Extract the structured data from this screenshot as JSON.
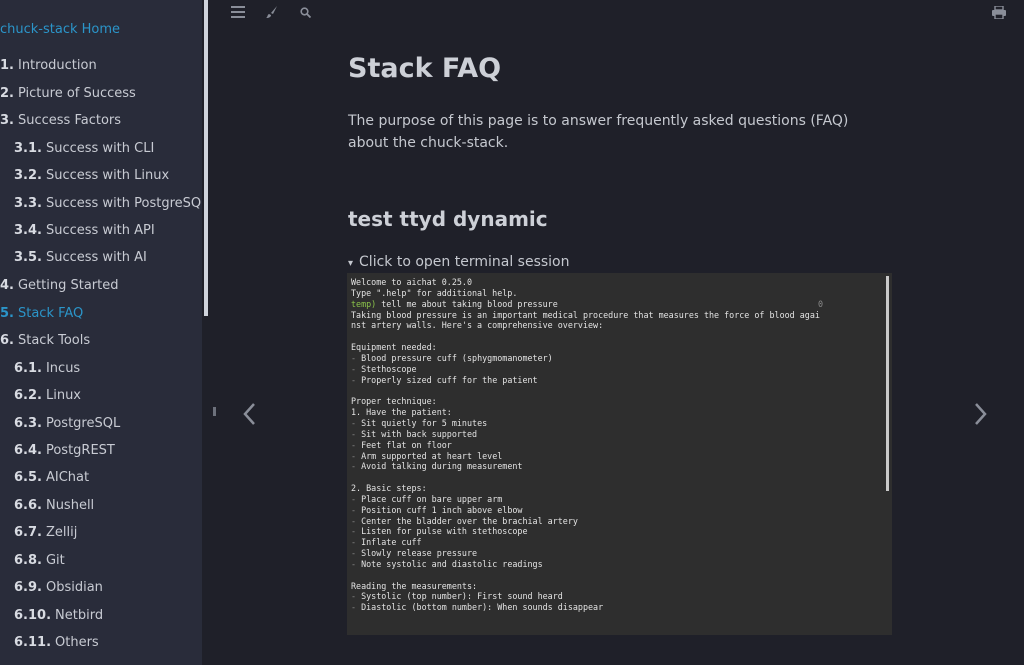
{
  "sidebar": {
    "home": "chuck-stack Home",
    "items": [
      {
        "num": "1.",
        "label": "Introduction"
      },
      {
        "num": "2.",
        "label": "Picture of Success"
      },
      {
        "num": "3.",
        "label": "Success Factors"
      },
      {
        "num": "3.1.",
        "label": "Success with CLI"
      },
      {
        "num": "3.2.",
        "label": "Success with Linux"
      },
      {
        "num": "3.3.",
        "label": "Success with PostgreSQL"
      },
      {
        "num": "3.4.",
        "label": "Success with API"
      },
      {
        "num": "3.5.",
        "label": "Success with AI"
      },
      {
        "num": "4.",
        "label": "Getting Started"
      },
      {
        "num": "5.",
        "label": "Stack FAQ"
      },
      {
        "num": "6.",
        "label": "Stack Tools"
      },
      {
        "num": "6.1.",
        "label": "Incus"
      },
      {
        "num": "6.2.",
        "label": "Linux"
      },
      {
        "num": "6.3.",
        "label": "PostgreSQL"
      },
      {
        "num": "6.4.",
        "label": "PostgREST"
      },
      {
        "num": "6.5.",
        "label": "AIChat"
      },
      {
        "num": "6.6.",
        "label": "Nushell"
      },
      {
        "num": "6.7.",
        "label": "Zellij"
      },
      {
        "num": "6.8.",
        "label": "Git"
      },
      {
        "num": "6.9.",
        "label": "Obsidian"
      },
      {
        "num": "6.10.",
        "label": "Netbird"
      },
      {
        "num": "6.11.",
        "label": "Others"
      }
    ]
  },
  "toolbar": {
    "icons": [
      "menu-icon",
      "brush-icon",
      "search-icon",
      "print-icon"
    ]
  },
  "main": {
    "title": "Stack FAQ",
    "intro": "The purpose of this page is to answer frequently asked questions (FAQ) about the chuck-stack.",
    "section_title": "test ttyd dynamic",
    "summary": "Click to open terminal session",
    "summary_marker": "▾"
  },
  "terminal": {
    "lines": [
      "Welcome to aichat 0.25.0",
      "Type \".help\" for additional help.",
      "",
      "Taking blood pressure is an important medical procedure that measures the force of blood agai",
      "nst artery walls. Here's a comprehensive overview:",
      "",
      "Equipment needed:",
      "- Blood pressure cuff (sphygmomanometer)",
      "- Stethoscope",
      "- Properly sized cuff for the patient",
      "",
      "Proper technique:",
      "1. Have the patient:",
      "- Sit quietly for 5 minutes",
      "- Sit with back supported",
      "- Feet flat on floor",
      "- Arm supported at heart level",
      "- Avoid talking during measurement",
      "",
      "2. Basic steps:",
      "- Place cuff on bare upper arm",
      "- Position cuff 1 inch above elbow",
      "- Center the bladder over the brachial artery",
      "- Listen for pulse with stethoscope",
      "- Inflate cuff",
      "- Slowly release pressure",
      "- Note systolic and diastolic readings",
      "",
      "Reading the measurements:",
      "- Systolic (top number): First sound heard",
      "- Diastolic (bottom number): When sounds disappear"
    ],
    "prompt_label": "temp)",
    "prompt_text": " tell me about taking blood pressure",
    "prompt_counter": "0"
  },
  "colors": {
    "accent": "#2b95c9",
    "background": "#1f2029",
    "sidebar": "#292c3a",
    "terminal_bg": "#2e2e2e",
    "prompt": "#8bc34a"
  }
}
